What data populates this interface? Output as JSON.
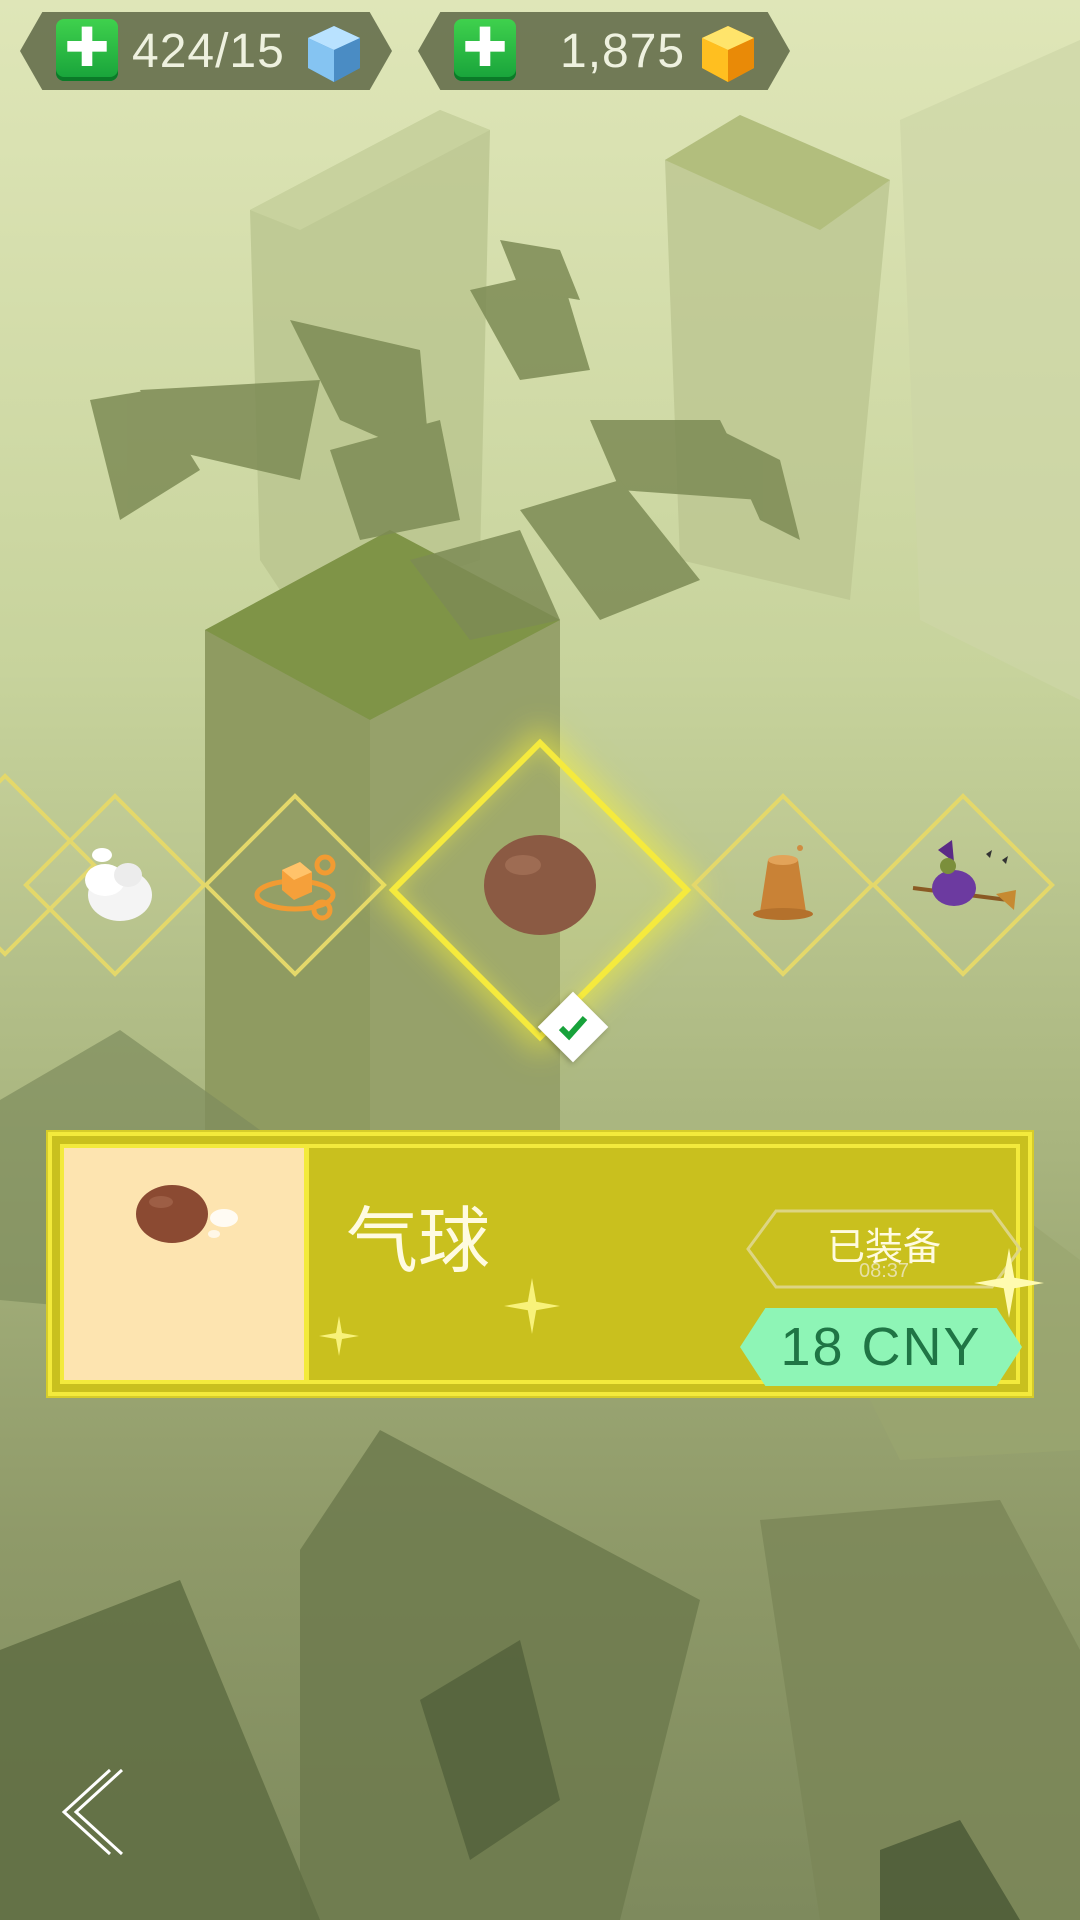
{
  "header": {
    "gems": {
      "count": "424/15",
      "icon": "blue-cube-icon",
      "plus_icon": "plus-icon"
    },
    "coins": {
      "count": "1,875",
      "icon": "gold-gem-icon",
      "plus_icon": "plus-icon"
    }
  },
  "carousel": {
    "items": [
      {
        "name": "cloud-item-icon"
      },
      {
        "name": "orbit-cube-item-icon"
      },
      {
        "name": "balloon-item-icon",
        "selected": true
      },
      {
        "name": "stump-item-icon"
      },
      {
        "name": "witch-item-icon"
      }
    ],
    "selected_check_icon": "checkmark-icon"
  },
  "panel": {
    "item_name": "气球",
    "equipped_label": "已装备",
    "equipped_time": "08:37",
    "price_label": "18 CNY"
  },
  "nav": {
    "back_icon": "back-chevron-icon"
  },
  "colors": {
    "panel_bg": "#c9c01e",
    "panel_border": "#f3ea3c",
    "thumb_bg": "#fde4b0",
    "price_bg": "#8ef5b6",
    "price_text": "#1f7545",
    "plus_green": "#17a23a"
  }
}
